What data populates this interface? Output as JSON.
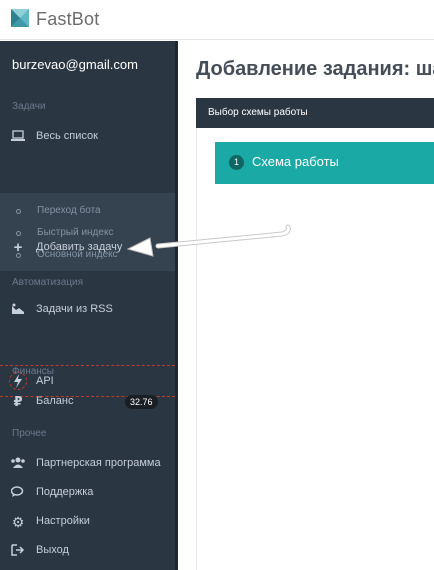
{
  "app": {
    "name": "FastBot"
  },
  "user": {
    "email": "burzevao@gmail.com"
  },
  "sidebar": {
    "sections": {
      "tasks": "Задачи",
      "automation": "Автоматизация",
      "finance": "Финансы",
      "other": "Прочее"
    },
    "all_list": "Весь список",
    "subitems": [
      "Переход бота",
      "Быстрый индекс",
      "Основной индекс"
    ],
    "add_task": "Добавить задачу",
    "rss_tasks": "Задачи из RSS",
    "api": "API",
    "balance": "Баланс",
    "balance_value": "32.76",
    "partner": "Партнерская программа",
    "support": "Поддержка",
    "settings": "Настройки",
    "logout": "Выход"
  },
  "main": {
    "title": "Добавление задания: ша",
    "panel_title": "Выбор схемы работы",
    "step_number": "1",
    "step_label": "Схема работы"
  },
  "colors": {
    "sidebar_bg": "#2b3643",
    "accent_teal": "#1aa9a4",
    "highlight_red": "#c0392b"
  },
  "icons": {
    "logo": "fastbot-logo-icon",
    "all_list": "laptop-icon",
    "add_task": "plus-icon",
    "rss": "rss-icon",
    "api": "bolt-icon",
    "balance": "ruble-icon",
    "partner": "users-icon",
    "support": "comments-icon",
    "settings": "gear-icon",
    "logout": "sign-out-icon",
    "annotation": "pointer-arrow-icon"
  }
}
